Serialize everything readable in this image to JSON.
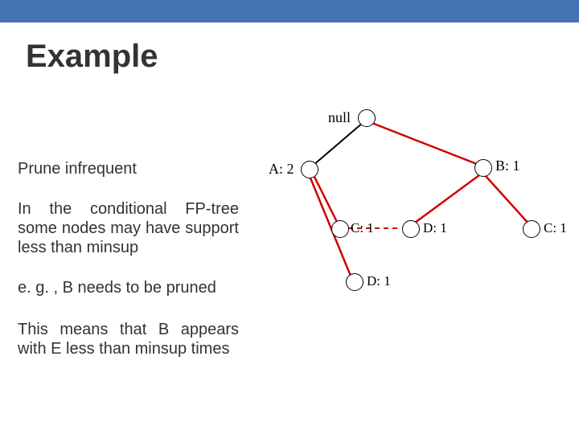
{
  "title": "Example",
  "text": {
    "prune": "Prune infrequent",
    "cond": "In the conditional FP-tree some nodes may have support less than minsup",
    "eg": "e. g. , B needs to be pruned",
    "means": "This means that B appears with E less than minsup times"
  },
  "nodes": {
    "null": "null",
    "A": "A: 2",
    "B": "B: 1",
    "C1": "C: 1",
    "D1a": "D: 1",
    "D1b": "D: 1",
    "C2": "C: 1"
  }
}
